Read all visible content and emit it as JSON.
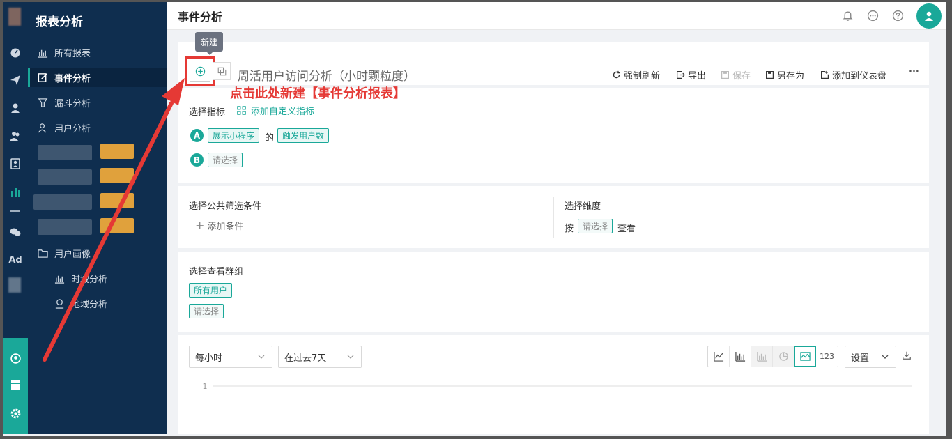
{
  "sidebar": {
    "title": "报表分析",
    "items": [
      {
        "label": "所有报表"
      },
      {
        "label": "事件分析"
      },
      {
        "label": "漏斗分析"
      },
      {
        "label": "用户分析"
      },
      {
        "label": "用户画像"
      },
      {
        "label": "时域分析"
      },
      {
        "label": "地域分析"
      }
    ]
  },
  "rail": {
    "ad_label": "Ad"
  },
  "header": {
    "title": "事件分析"
  },
  "toolbar": {
    "tooltip": "新建",
    "report_title": "周活用户访问分析（小时颗粒度）",
    "refresh": "强制刷新",
    "export": "导出",
    "save": "保存",
    "save_as": "另存为",
    "add_to_dashboard": "添加到仪表盘",
    "more": "···"
  },
  "annotation": "点击此处新建【事件分析报表】",
  "metrics": {
    "label": "选择指标",
    "add_custom": "添加自定义指标",
    "row_a": {
      "badge": "A",
      "event": "展示小程序",
      "connector": "的",
      "measure": "触发用户数"
    },
    "row_b": {
      "badge": "B",
      "placeholder": "请选择"
    }
  },
  "filters": {
    "label": "选择公共筛选条件",
    "add_condition": "添加条件"
  },
  "dimension": {
    "label": "选择维度",
    "prefix": "按",
    "placeholder": "请选择",
    "suffix": "查看"
  },
  "groups": {
    "label": "选择查看群组",
    "all_users": "所有用户",
    "placeholder": "请选择"
  },
  "chart_controls": {
    "granularity": "每小时",
    "range": "在过去7天",
    "number_btn": "123",
    "settings": "设置"
  },
  "chart_data": {
    "type": "line",
    "y_tick": "1"
  },
  "colors": {
    "accent": "#1aa899",
    "sidebar": "#0f2e4f",
    "annotation": "#e53935"
  }
}
